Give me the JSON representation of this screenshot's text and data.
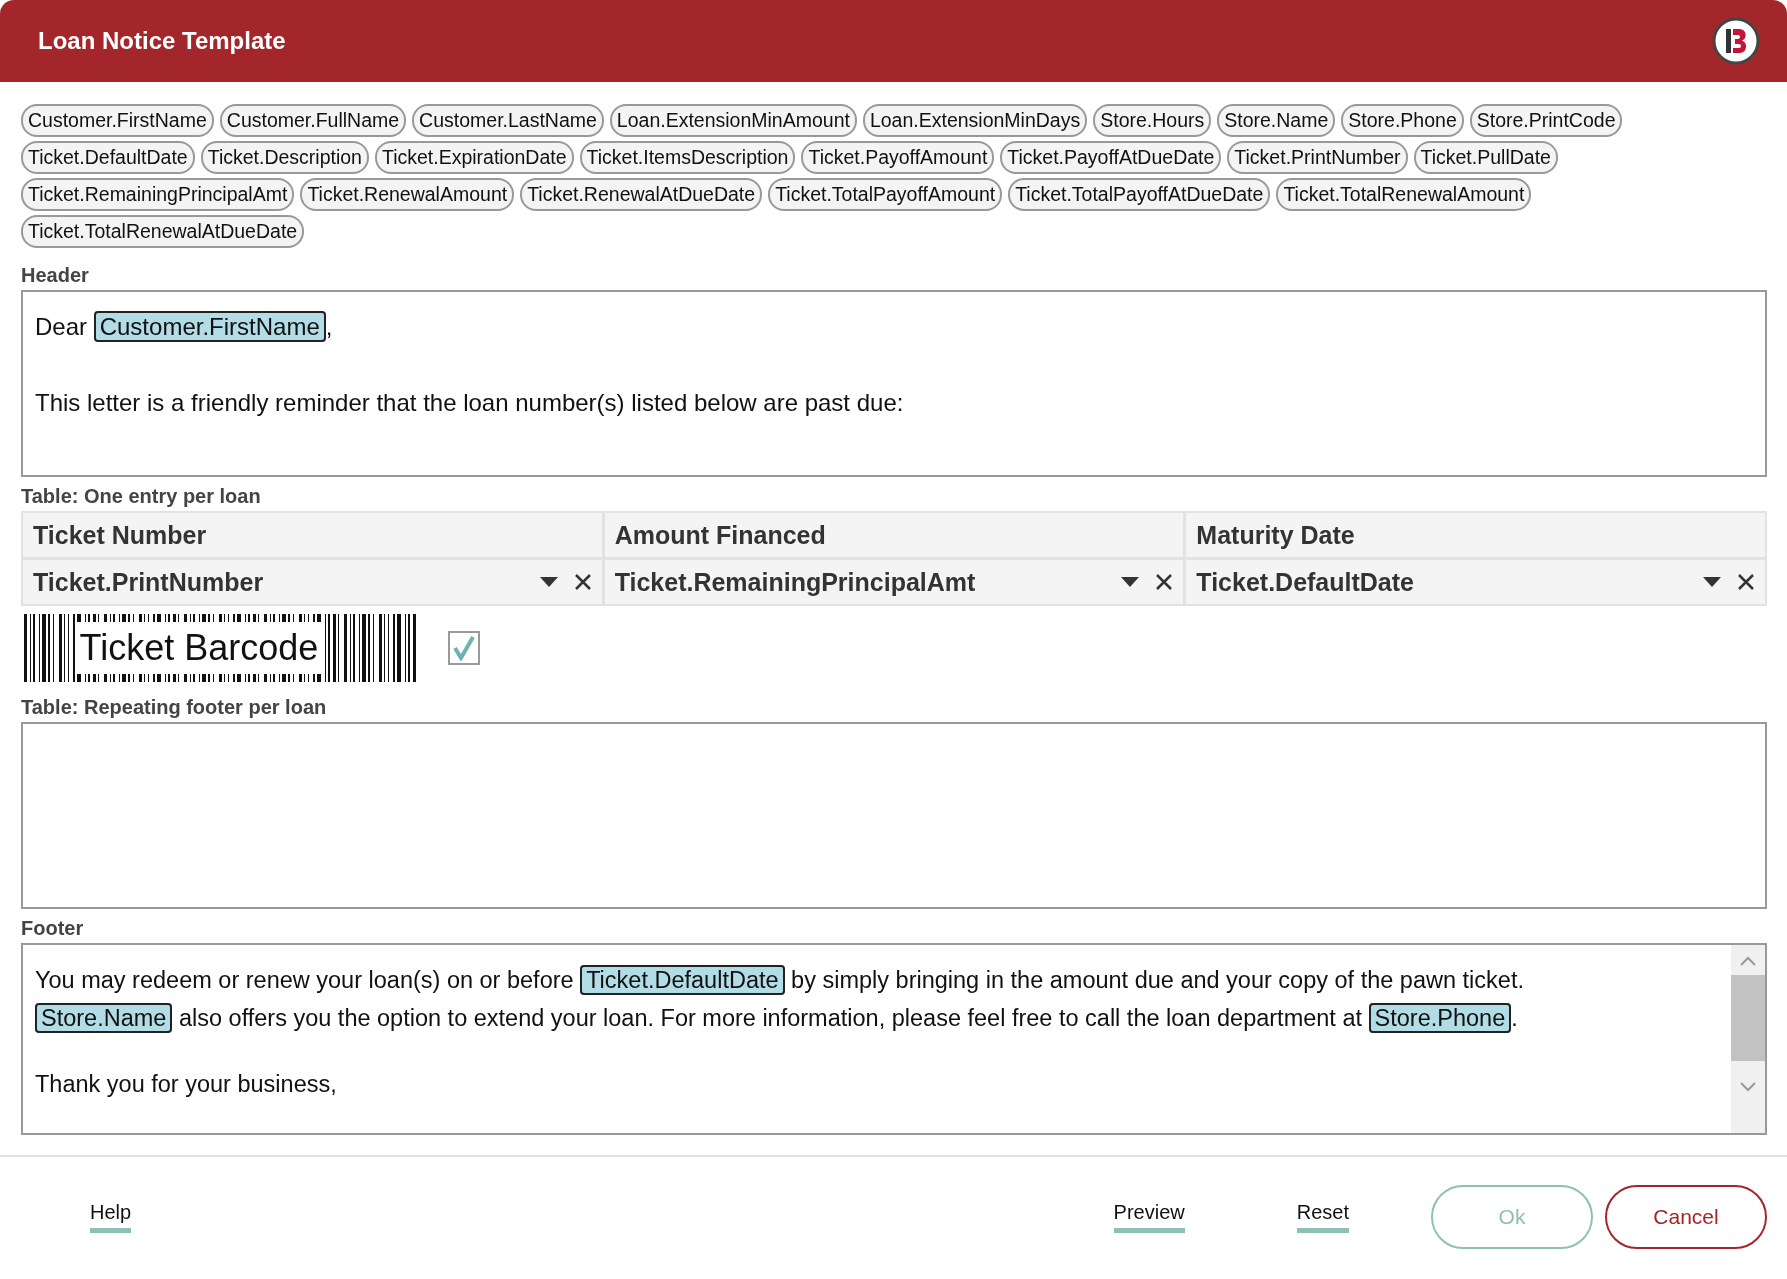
{
  "window": {
    "title": "Loan Notice Template"
  },
  "fields": [
    "Customer.FirstName",
    "Customer.FullName",
    "Customer.LastName",
    "Loan.ExtensionMinAmount",
    "Loan.ExtensionMinDays",
    "Store.Hours",
    "Store.Name",
    "Store.Phone",
    "Store.PrintCode",
    "Ticket.DefaultDate",
    "Ticket.Description",
    "Ticket.ExpirationDate",
    "Ticket.ItemsDescription",
    "Ticket.PayoffAmount",
    "Ticket.PayoffAtDueDate",
    "Ticket.PrintNumber",
    "Ticket.PullDate",
    "Ticket.RemainingPrincipalAmt",
    "Ticket.RenewalAmount",
    "Ticket.RenewalAtDueDate",
    "Ticket.TotalPayoffAmount",
    "Ticket.TotalPayoffAtDueDate",
    "Ticket.TotalRenewalAmount",
    "Ticket.TotalRenewalAtDueDate"
  ],
  "header": {
    "label": "Header",
    "paragraphs": [
      [
        {
          "kind": "text",
          "text": "Dear "
        },
        {
          "kind": "token",
          "text": "Customer.FirstName"
        },
        {
          "kind": "text",
          "text": ","
        }
      ],
      [
        {
          "kind": "text",
          "text": "This letter is a friendly reminder that the loan number(s) listed below are past due:"
        }
      ]
    ]
  },
  "table": {
    "label": "Table: One entry per loan",
    "columns": [
      "Ticket Number",
      "Amount Financed",
      "Maturity Date"
    ],
    "values": [
      "Ticket.PrintNumber",
      "Ticket.RemainingPrincipalAmt",
      "Ticket.DefaultDate"
    ]
  },
  "barcode": {
    "label": "Ticket Barcode",
    "checked": true
  },
  "repeating_footer": {
    "label": "Table: Repeating footer per loan"
  },
  "footer": {
    "label": "Footer",
    "paragraphs": [
      [
        {
          "kind": "text",
          "text": "You may redeem or renew your loan(s) on or before "
        },
        {
          "kind": "token",
          "text": "Ticket.DefaultDate"
        },
        {
          "kind": "text",
          "text": " by simply bringing in the amount due and your copy of the pawn ticket. "
        },
        {
          "kind": "token",
          "text": "Store.Name"
        },
        {
          "kind": "text",
          "text": " also offers you the option to extend your loan. For more information, please feel free to call the loan department at "
        },
        {
          "kind": "token",
          "text": "Store.Phone"
        },
        {
          "kind": "text",
          "text": "."
        }
      ],
      [
        {
          "kind": "text",
          "text": "Thank you for your business,"
        }
      ]
    ]
  },
  "links": [
    "Help",
    "Preview",
    "Reset"
  ],
  "buttons": [
    {
      "label": "Ok",
      "kind": "primary",
      "disabled": true
    },
    {
      "label": "Cancel",
      "kind": "cancel",
      "disabled": false
    }
  ]
}
